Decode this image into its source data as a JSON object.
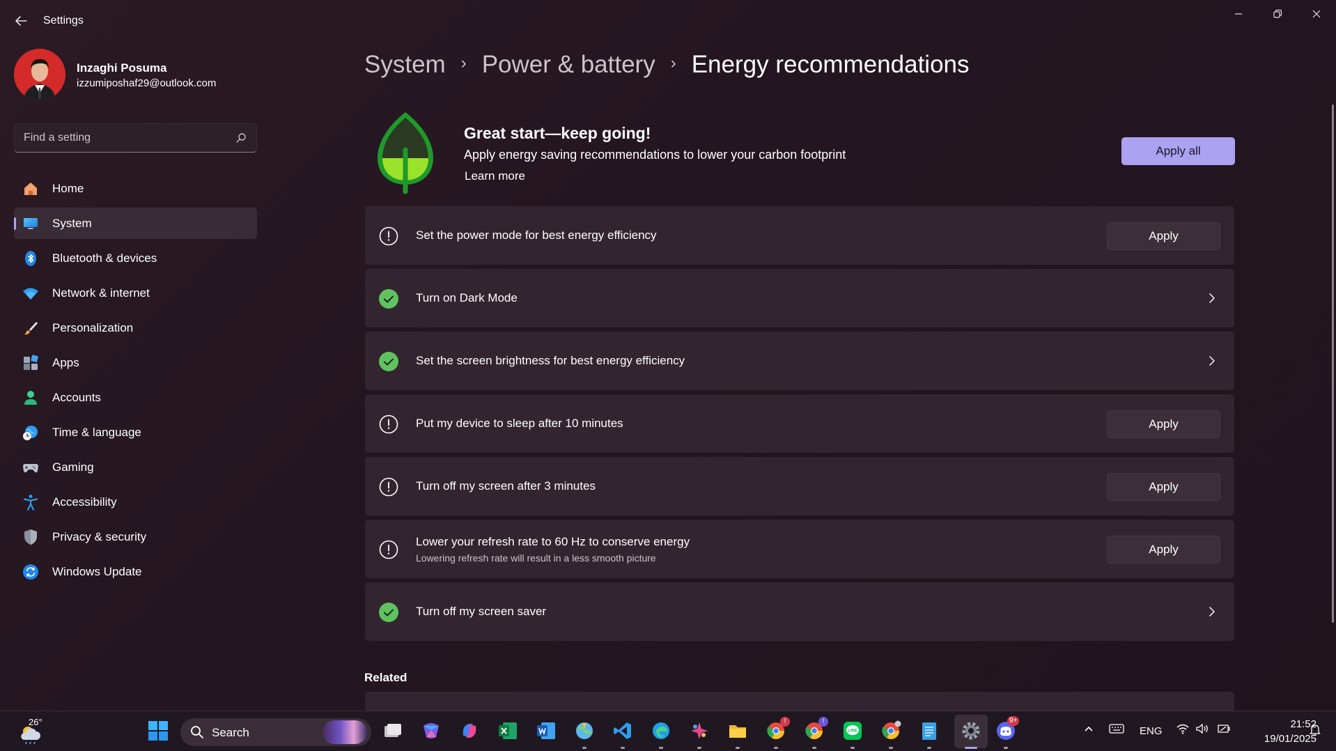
{
  "window": {
    "title": "Settings"
  },
  "profile": {
    "name": "Inzaghi Posuma",
    "email": "izzumiposhaf29@outlook.com"
  },
  "search": {
    "placeholder": "Find a setting"
  },
  "sidebar": {
    "items": [
      {
        "label": "Home",
        "icon": "home-icon",
        "active": false
      },
      {
        "label": "System",
        "icon": "system-icon",
        "active": true
      },
      {
        "label": "Bluetooth & devices",
        "icon": "bluetooth-icon",
        "active": false
      },
      {
        "label": "Network & internet",
        "icon": "wifi-icon",
        "active": false
      },
      {
        "label": "Personalization",
        "icon": "brush-icon",
        "active": false
      },
      {
        "label": "Apps",
        "icon": "apps-icon",
        "active": false
      },
      {
        "label": "Accounts",
        "icon": "accounts-icon",
        "active": false
      },
      {
        "label": "Time & language",
        "icon": "time-language-icon",
        "active": false
      },
      {
        "label": "Gaming",
        "icon": "gamepad-icon",
        "active": false
      },
      {
        "label": "Accessibility",
        "icon": "accessibility-icon",
        "active": false
      },
      {
        "label": "Privacy & security",
        "icon": "shield-icon",
        "active": false
      },
      {
        "label": "Windows Update",
        "icon": "update-icon",
        "active": false
      }
    ]
  },
  "breadcrumb": {
    "items": [
      "System",
      "Power & battery"
    ],
    "current": "Energy recommendations"
  },
  "hero": {
    "title": "Great start—keep going!",
    "subtitle": "Apply energy saving recommendations to lower your carbon footprint",
    "link": "Learn more",
    "apply_all": "Apply all"
  },
  "recommendations": [
    {
      "title": "Set the power mode for best energy efficiency",
      "description": "",
      "status": "pending",
      "action": "Apply"
    },
    {
      "title": "Turn on Dark Mode",
      "description": "",
      "status": "done",
      "action": ""
    },
    {
      "title": "Set the screen brightness for best energy efficiency",
      "description": "",
      "status": "done",
      "action": ""
    },
    {
      "title": "Put my device to sleep after 10 minutes",
      "description": "",
      "status": "pending",
      "action": "Apply"
    },
    {
      "title": "Turn off my screen after 3 minutes",
      "description": "",
      "status": "pending",
      "action": "Apply"
    },
    {
      "title": "Lower your refresh rate to 60 Hz to conserve energy",
      "description": "Lowering refresh rate will result in a less smooth picture",
      "status": "pending",
      "action": "Apply"
    },
    {
      "title": "Turn off my screen saver",
      "description": "",
      "status": "done",
      "action": ""
    }
  ],
  "related": {
    "heading": "Related"
  },
  "colors": {
    "accent": "#aba3f2",
    "success": "#5fc25f",
    "leaf": "#8edc2a"
  },
  "taskbar": {
    "weather_temp": "26°",
    "search_label": "Search",
    "language": "ENG",
    "time": "21:52",
    "date": "19/01/2025",
    "apps": [
      {
        "name": "start-icon"
      },
      {
        "name": "task-view-icon"
      },
      {
        "name": "m365-icon"
      },
      {
        "name": "copilot-icon"
      },
      {
        "name": "excel-icon"
      },
      {
        "name": "word-icon"
      },
      {
        "name": "maps-icon"
      },
      {
        "name": "vscode-icon"
      },
      {
        "name": "edge-icon"
      },
      {
        "name": "sparkle-app-icon"
      },
      {
        "name": "file-explorer-icon"
      },
      {
        "name": "chrome-icon"
      },
      {
        "name": "chrome-profile-icon"
      },
      {
        "name": "line-icon"
      },
      {
        "name": "chrome-profile-2-icon"
      },
      {
        "name": "notepad-icon"
      },
      {
        "name": "settings-icon"
      },
      {
        "name": "discord-icon"
      }
    ],
    "badges": {
      "chrome": "!",
      "chrome_profile": "!",
      "discord": "9+"
    }
  }
}
